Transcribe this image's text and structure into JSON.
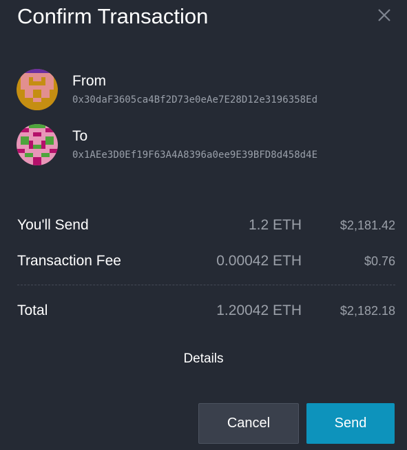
{
  "dialog": {
    "title": "Confirm Transaction"
  },
  "from": {
    "label": "From",
    "address": "0x30daF3605ca4Bf2D73e0eAe7E28D12e3196358Ed"
  },
  "to": {
    "label": "To",
    "address": "0x1AEe3D0Ef19F63A4A8396a0ee9E39BFD8d458d4E"
  },
  "summary": {
    "send": {
      "label": "You'll Send",
      "amount": "1.2 ETH",
      "usd": "$2,181.42"
    },
    "fee": {
      "label": "Transaction Fee",
      "amount": "0.00042 ETH",
      "usd": "$0.76"
    },
    "total": {
      "label": "Total",
      "amount": "1.20042 ETH",
      "usd": "$2,182.18"
    }
  },
  "details_label": "Details",
  "buttons": {
    "cancel": "Cancel",
    "send": "Send"
  },
  "colors": {
    "background": "#252a34",
    "send_button": "#0d93bc",
    "cancel_button": "#3a404c",
    "muted_text": "#9ba0a9"
  },
  "icons": {
    "close": "close-icon",
    "from_avatar": "identicon-avatar",
    "to_avatar": "identicon-avatar"
  }
}
